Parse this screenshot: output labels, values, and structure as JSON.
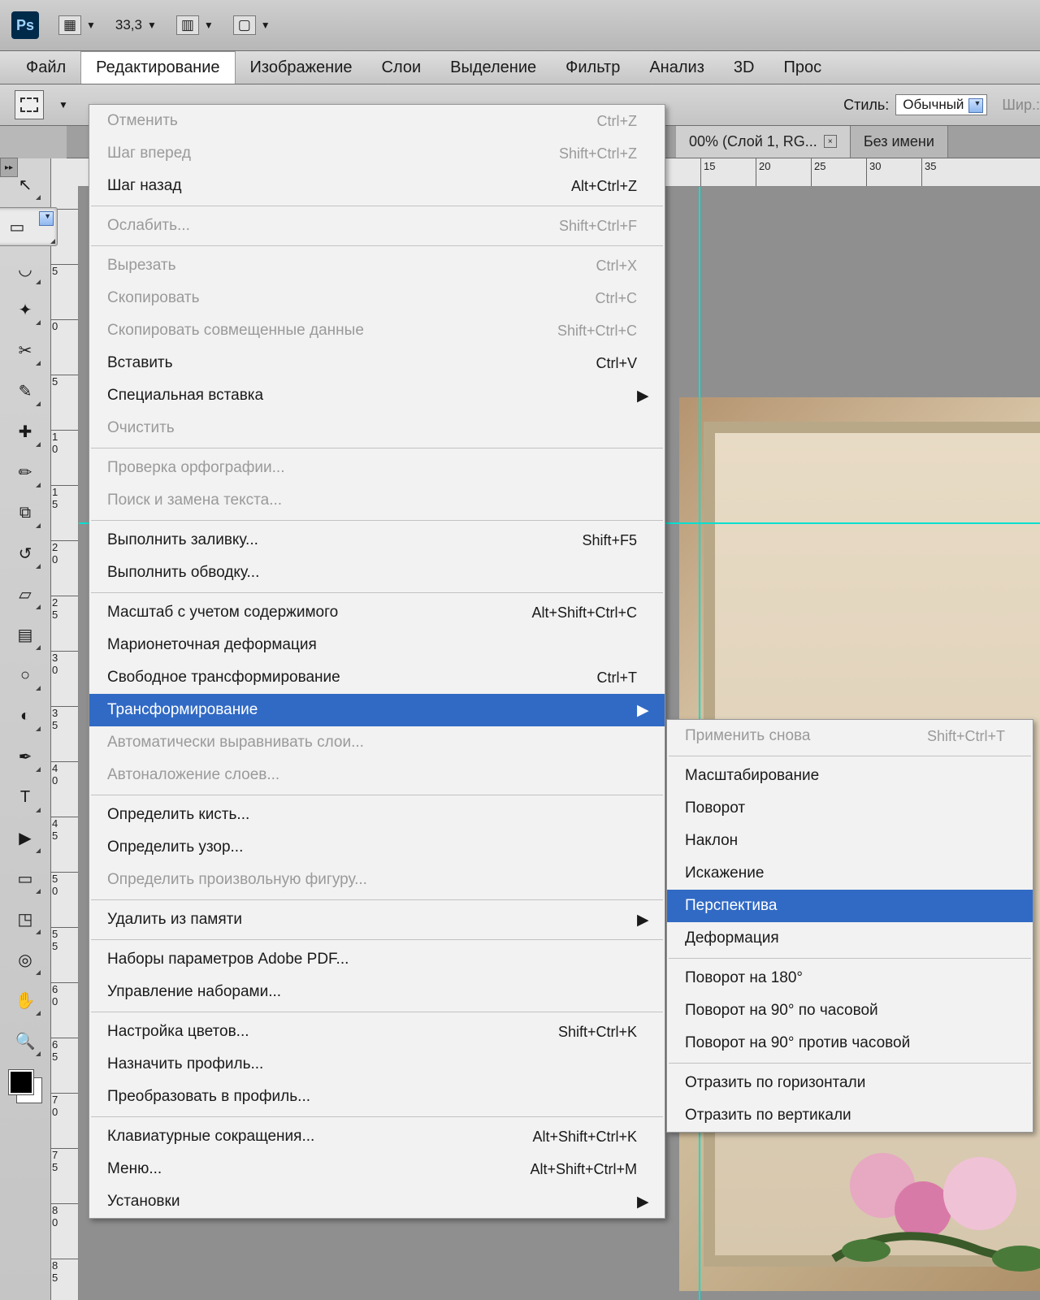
{
  "toolbar": {
    "zoom": "33,3",
    "style_label": "Стиль:",
    "style_value": "Обычный",
    "width_label": "Шир.:"
  },
  "menubar": {
    "items": [
      "Файл",
      "Редактирование",
      "Изображение",
      "Слои",
      "Выделение",
      "Фильтр",
      "Анализ",
      "3D",
      "Прос"
    ]
  },
  "tabs": {
    "active": "00% (Слой 1, RG...",
    "other": "Без имени"
  },
  "hruler_ticks": [
    {
      "pos": 862,
      "label": "15"
    },
    {
      "pos": 930,
      "label": "20"
    },
    {
      "pos": 998,
      "label": "25"
    },
    {
      "pos": 1066,
      "label": "30"
    },
    {
      "pos": 1134,
      "label": "35"
    }
  ],
  "vruler_ticks": [
    {
      "pos": 62,
      "label": "0"
    },
    {
      "pos": 130,
      "label": "5"
    },
    {
      "pos": 198,
      "label": "0"
    },
    {
      "pos": 266,
      "label": "5"
    },
    {
      "pos": 334,
      "label": "1\n0"
    },
    {
      "pos": 402,
      "label": "1\n5"
    },
    {
      "pos": 470,
      "label": "2\n0"
    },
    {
      "pos": 538,
      "label": "2\n5"
    },
    {
      "pos": 606,
      "label": "3\n0"
    },
    {
      "pos": 674,
      "label": "3\n5"
    },
    {
      "pos": 742,
      "label": "4\n0"
    },
    {
      "pos": 810,
      "label": "4\n5"
    },
    {
      "pos": 878,
      "label": "5\n0"
    },
    {
      "pos": 946,
      "label": "5\n5"
    },
    {
      "pos": 1014,
      "label": "6\n0"
    },
    {
      "pos": 1082,
      "label": "6\n5"
    },
    {
      "pos": 1150,
      "label": "7\n0"
    },
    {
      "pos": 1218,
      "label": "7\n5"
    },
    {
      "pos": 1286,
      "label": "8\n0"
    },
    {
      "pos": 1354,
      "label": "8\n5"
    }
  ],
  "edit_menu": [
    {
      "label": "Отменить",
      "sc": "Ctrl+Z",
      "disabled": true
    },
    {
      "label": "Шаг вперед",
      "sc": "Shift+Ctrl+Z",
      "disabled": true
    },
    {
      "label": "Шаг назад",
      "sc": "Alt+Ctrl+Z"
    },
    {
      "sep": true
    },
    {
      "label": "Ослабить...",
      "sc": "Shift+Ctrl+F",
      "disabled": true
    },
    {
      "sep": true
    },
    {
      "label": "Вырезать",
      "sc": "Ctrl+X",
      "disabled": true
    },
    {
      "label": "Скопировать",
      "sc": "Ctrl+C",
      "disabled": true
    },
    {
      "label": "Скопировать совмещенные данные",
      "sc": "Shift+Ctrl+C",
      "disabled": true
    },
    {
      "label": "Вставить",
      "sc": "Ctrl+V"
    },
    {
      "label": "Специальная вставка",
      "submenu": true
    },
    {
      "label": "Очистить",
      "disabled": true
    },
    {
      "sep": true
    },
    {
      "label": "Проверка орфографии...",
      "disabled": true
    },
    {
      "label": "Поиск и замена текста...",
      "disabled": true
    },
    {
      "sep": true
    },
    {
      "label": "Выполнить заливку...",
      "sc": "Shift+F5"
    },
    {
      "label": "Выполнить обводку..."
    },
    {
      "sep": true
    },
    {
      "label": "Масштаб с учетом содержимого",
      "sc": "Alt+Shift+Ctrl+C"
    },
    {
      "label": "Марионеточная деформация"
    },
    {
      "label": "Свободное трансформирование",
      "sc": "Ctrl+T"
    },
    {
      "label": "Трансформирование",
      "submenu": true,
      "hl": true
    },
    {
      "label": "Автоматически выравнивать слои...",
      "disabled": true
    },
    {
      "label": "Автоналожение слоев...",
      "disabled": true
    },
    {
      "sep": true
    },
    {
      "label": "Определить кисть..."
    },
    {
      "label": "Определить узор..."
    },
    {
      "label": "Определить произвольную фигуру...",
      "disabled": true
    },
    {
      "sep": true
    },
    {
      "label": "Удалить из памяти",
      "submenu": true
    },
    {
      "sep": true
    },
    {
      "label": "Наборы параметров Adobe PDF..."
    },
    {
      "label": "Управление наборами..."
    },
    {
      "sep": true
    },
    {
      "label": "Настройка цветов...",
      "sc": "Shift+Ctrl+K"
    },
    {
      "label": "Назначить профиль..."
    },
    {
      "label": "Преобразовать в профиль..."
    },
    {
      "sep": true
    },
    {
      "label": "Клавиатурные сокращения...",
      "sc": "Alt+Shift+Ctrl+K"
    },
    {
      "label": "Меню...",
      "sc": "Alt+Shift+Ctrl+M"
    },
    {
      "label": "Установки",
      "submenu": true
    }
  ],
  "transform_submenu": [
    {
      "label": "Применить снова",
      "sc": "Shift+Ctrl+T",
      "disabled": true
    },
    {
      "sep": true
    },
    {
      "label": "Масштабирование"
    },
    {
      "label": "Поворот"
    },
    {
      "label": "Наклон"
    },
    {
      "label": "Искажение"
    },
    {
      "label": "Перспектива",
      "hl": true
    },
    {
      "label": "Деформация"
    },
    {
      "sep": true
    },
    {
      "label": "Поворот на 180°"
    },
    {
      "label": "Поворот на 90° по часовой"
    },
    {
      "label": "Поворот на 90° против часовой"
    },
    {
      "sep": true
    },
    {
      "label": "Отразить по горизонтали"
    },
    {
      "label": "Отразить по вертикали"
    }
  ],
  "tools": [
    {
      "name": "move-tool",
      "glyph": "↖"
    },
    {
      "name": "marquee-tool",
      "glyph": "▭",
      "selected": true
    },
    {
      "name": "lasso-tool",
      "glyph": "◡"
    },
    {
      "name": "magic-wand-tool",
      "glyph": "✦"
    },
    {
      "name": "crop-tool",
      "glyph": "✂"
    },
    {
      "name": "eyedropper-tool",
      "glyph": "✎"
    },
    {
      "name": "healing-brush-tool",
      "glyph": "✚"
    },
    {
      "name": "brush-tool",
      "glyph": "✏"
    },
    {
      "name": "stamp-tool",
      "glyph": "⧉"
    },
    {
      "name": "history-brush-tool",
      "glyph": "↺"
    },
    {
      "name": "eraser-tool",
      "glyph": "▱"
    },
    {
      "name": "gradient-tool",
      "glyph": "▤"
    },
    {
      "name": "blur-tool",
      "glyph": "○"
    },
    {
      "name": "dodge-tool",
      "glyph": "◐"
    },
    {
      "name": "pen-tool",
      "glyph": "✒"
    },
    {
      "name": "type-tool",
      "glyph": "T"
    },
    {
      "name": "path-selection-tool",
      "glyph": "▶"
    },
    {
      "name": "shape-tool",
      "glyph": "▭"
    },
    {
      "name": "3d-tool",
      "glyph": "◳"
    },
    {
      "name": "camera-tool",
      "glyph": "◎"
    },
    {
      "name": "hand-tool",
      "glyph": "✋"
    },
    {
      "name": "zoom-tool",
      "glyph": "🔍"
    }
  ]
}
